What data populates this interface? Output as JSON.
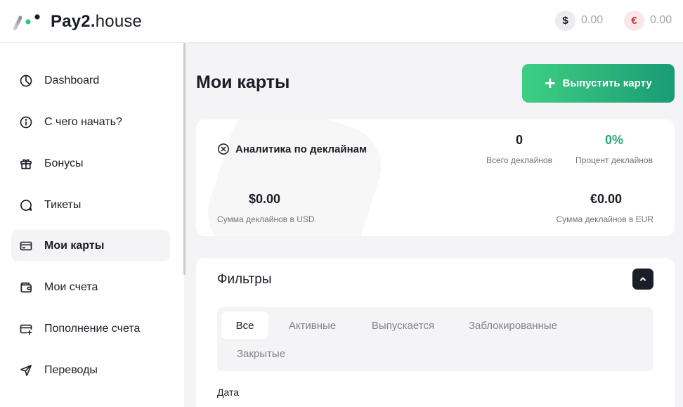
{
  "header": {
    "logo_bold": "Pay2.",
    "logo_light": "house",
    "balance_usd": {
      "symbol": "$",
      "value": "0.00"
    },
    "balance_eur": {
      "symbol": "€",
      "value": "0.00"
    }
  },
  "sidebar": {
    "items": [
      {
        "label": "Dashboard",
        "icon": "dashboard-icon"
      },
      {
        "label": "С чего начать?",
        "icon": "info-icon"
      },
      {
        "label": "Бонусы",
        "icon": "gift-icon"
      },
      {
        "label": "Тикеты",
        "icon": "chat-icon"
      },
      {
        "label": "Мои карты",
        "icon": "card-icon",
        "active": true
      },
      {
        "label": "Мои счета",
        "icon": "wallet-icon"
      },
      {
        "label": "Пополнение счета",
        "icon": "card-add-icon"
      },
      {
        "label": "Переводы",
        "icon": "send-icon"
      }
    ]
  },
  "main": {
    "title": "Мои карты",
    "issue_button": {
      "icon": "+",
      "label": "Выпустить карту"
    },
    "analytics": {
      "title": "Аналитика по деклайнам",
      "total_value": "0",
      "total_label": "Всего деклайнов",
      "percent_value": "0%",
      "percent_label": "Процент деклайнов",
      "usd_value": "$0.00",
      "usd_label": "Сумма деклайнов в USD",
      "eur_value": "€0.00",
      "eur_label": "Сумма деклайнов в EUR"
    },
    "filters": {
      "title": "Фильтры",
      "tabs": [
        "Все",
        "Активные",
        "Выпускается",
        "Заблокированные",
        "Закрытые"
      ],
      "active_tab": "Все",
      "date_label": "Дата"
    }
  },
  "colors": {
    "accent_start": "#3ecf82",
    "accent_end": "#1a9b75",
    "percent_green": "#2ba67c",
    "euro_red": "#c8343b"
  }
}
